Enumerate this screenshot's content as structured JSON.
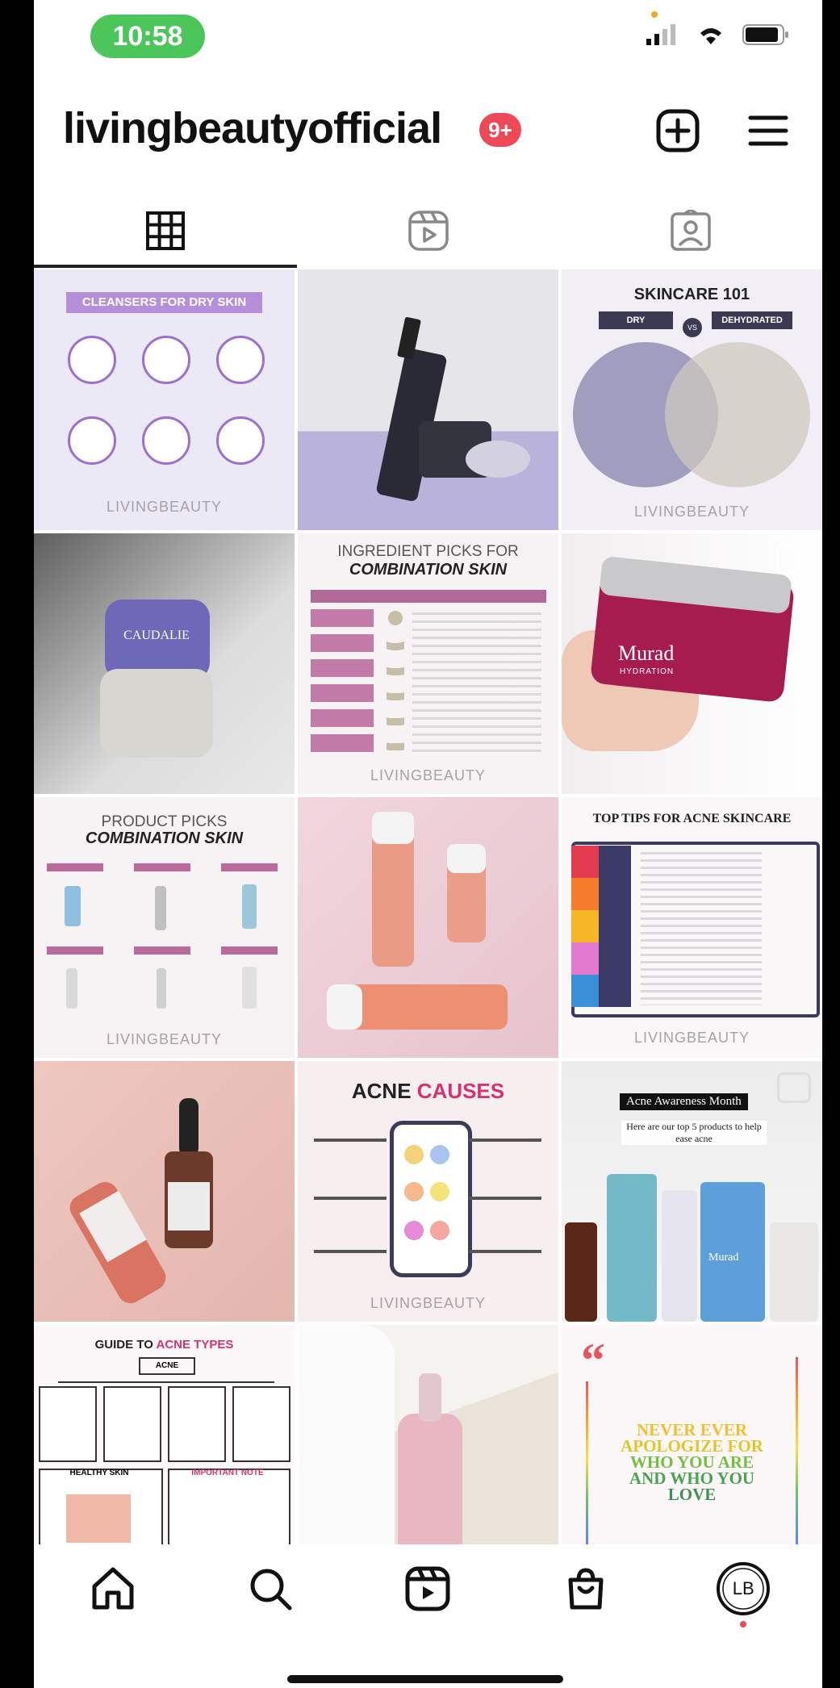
{
  "status": {
    "time": "10:58"
  },
  "header": {
    "username": "livingbeautyofficial",
    "badge": "9+"
  },
  "tabs": [
    {
      "name": "posts-grid",
      "icon": "grid-icon",
      "active": true
    },
    {
      "name": "reels",
      "icon": "reels-icon",
      "active": false
    },
    {
      "name": "tagged",
      "icon": "tagged-person-icon",
      "active": false
    }
  ],
  "tiles": {
    "t1": {
      "title": "CLEANSERS FOR DRY SKIN",
      "logo": "LIVINGBEAUTY"
    },
    "t3": {
      "title": "SKINCARE 101",
      "left": "DRY",
      "vs": "VS",
      "right": "DEHYDRATED",
      "logo": "LIVINGBEAUTY"
    },
    "t4": {
      "brand": "CAUDALIE"
    },
    "t5": {
      "line1": "INGREDIENT PICKS FOR",
      "line2": "COMBINATION SKIN",
      "logo": "LIVINGBEAUTY"
    },
    "t6": {
      "brand": "Murad",
      "sub": "HYDRATION"
    },
    "t7": {
      "line1": "PRODUCT PICKS",
      "line2": "COMBINATION SKIN",
      "logo": "LIVINGBEAUTY"
    },
    "t9": {
      "title": "TOP TIPS FOR ACNE SKINCARE",
      "logo": "LIVINGBEAUTY"
    },
    "t11": {
      "title_a": "ACNE ",
      "title_b": "CAUSES",
      "logo": "LIVINGBEAUTY"
    },
    "t12": {
      "title": "Acne Awareness Month",
      "subtitle": "Here are our top 5 products to help ease acne",
      "brand": "Murad"
    },
    "t13": {
      "title_a": "GUIDE TO ",
      "title_b": "ACNE TYPES",
      "box": "ACNE",
      "healthy": "HEALTHY SKIN",
      "important": "IMPORTANT NOTE"
    },
    "t15": {
      "quote_mark": "“",
      "l1": "NEVER EVER",
      "l2": "APOLOGIZE FOR",
      "l3": "WHO YOU ARE",
      "l4": "AND WHO YOU",
      "l5": "LOVE"
    }
  },
  "bottom_nav": [
    {
      "name": "home",
      "icon": "home-icon"
    },
    {
      "name": "search",
      "icon": "search-icon"
    },
    {
      "name": "reels",
      "icon": "reels-icon"
    },
    {
      "name": "shop",
      "icon": "shopping-bag-icon"
    },
    {
      "name": "profile",
      "icon": "avatar-icon",
      "label": "LB"
    }
  ],
  "colors": {
    "accent_pink": "#ed4956",
    "pill_green": "#4cc65b",
    "lavender": "#b590d8"
  }
}
